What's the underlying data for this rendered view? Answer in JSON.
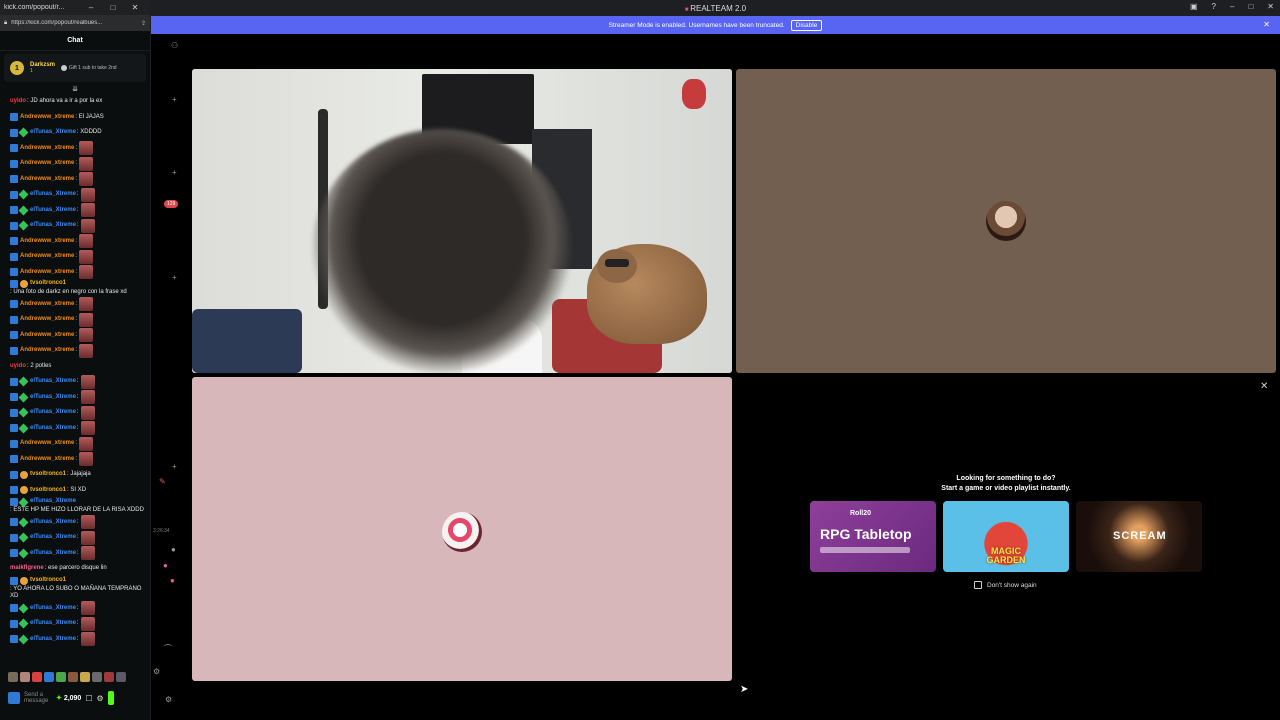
{
  "chat_window": {
    "title": "kick.com/popout/r...",
    "url": "https://kick.com/popout/realbues...",
    "header": "Chat",
    "pinned": {
      "avatar_letter": "1",
      "name": "Darkzsm",
      "sub_count": "1",
      "gift_text": "Gift 1 sub to take 2nd"
    },
    "collapse_icon": "chevron-double-down",
    "messages": [
      {
        "badges": [],
        "user": "uyido",
        "color": "red",
        "text": ": JD ahora va a ir a por la ex",
        "emote": false
      },
      {
        "badges": [
          "kick"
        ],
        "user": "Andrewww_xtreme",
        "color": "orange",
        "text": ": El JAJAS",
        "emote": false
      },
      {
        "badges": [
          "kick",
          "gem"
        ],
        "user": "elTunas_Xtreme",
        "color": "blue",
        "text": ": XDDDD",
        "emote": false
      },
      {
        "badges": [
          "kick"
        ],
        "user": "Andrewww_xtreme",
        "color": "orange",
        "text": ":",
        "emote": true
      },
      {
        "badges": [
          "kick"
        ],
        "user": "Andrewww_xtreme",
        "color": "orange",
        "text": ":",
        "emote": true
      },
      {
        "badges": [
          "kick"
        ],
        "user": "Andrewww_xtreme",
        "color": "orange",
        "text": ":",
        "emote": true
      },
      {
        "badges": [
          "kick",
          "gem"
        ],
        "user": "elTunas_Xtreme",
        "color": "blue",
        "text": ":",
        "emote": true
      },
      {
        "badges": [
          "kick",
          "gem"
        ],
        "user": "elTunas_Xtreme",
        "color": "blue",
        "text": ":",
        "emote": true
      },
      {
        "badges": [
          "kick",
          "gem"
        ],
        "user": "elTunas_Xtreme",
        "color": "blue",
        "text": ":",
        "emote": true
      },
      {
        "badges": [
          "kick"
        ],
        "user": "Andrewww_xtreme",
        "color": "orange",
        "text": ":",
        "emote": true
      },
      {
        "badges": [
          "kick"
        ],
        "user": "Andrewww_xtreme",
        "color": "orange",
        "text": ":",
        "emote": true
      },
      {
        "badges": [
          "kick"
        ],
        "user": "Andrewww_xtreme",
        "color": "orange",
        "text": ":",
        "emote": true
      },
      {
        "badges": [
          "kick",
          "crown"
        ],
        "user": "tvsoltronco1",
        "color": "gold",
        "text": ": Una foto de darkz en negro con la frase xd",
        "emote": false
      },
      {
        "badges": [
          "kick"
        ],
        "user": "Andrewww_xtreme",
        "color": "orange",
        "text": ":",
        "emote": true
      },
      {
        "badges": [
          "kick"
        ],
        "user": "Andrewww_xtreme",
        "color": "orange",
        "text": ":",
        "emote": true
      },
      {
        "badges": [
          "kick"
        ],
        "user": "Andrewww_xtreme",
        "color": "orange",
        "text": ":",
        "emote": true
      },
      {
        "badges": [
          "kick"
        ],
        "user": "Andrewww_xtreme",
        "color": "orange",
        "text": ":",
        "emote": true
      },
      {
        "badges": [],
        "user": "uyido",
        "color": "red",
        "text": ": 2 potles",
        "emote": false
      },
      {
        "badges": [
          "kick",
          "gem"
        ],
        "user": "elTunas_Xtreme",
        "color": "blue",
        "text": ":",
        "emote": true
      },
      {
        "badges": [
          "kick",
          "gem"
        ],
        "user": "elTunas_Xtreme",
        "color": "blue",
        "text": ":",
        "emote": true
      },
      {
        "badges": [
          "kick",
          "gem"
        ],
        "user": "elTunas_Xtreme",
        "color": "blue",
        "text": ":",
        "emote": true
      },
      {
        "badges": [
          "kick",
          "gem"
        ],
        "user": "elTunas_Xtreme",
        "color": "blue",
        "text": ":",
        "emote": true
      },
      {
        "badges": [
          "kick"
        ],
        "user": "Andrewww_xtreme",
        "color": "orange",
        "text": ":",
        "emote": true
      },
      {
        "badges": [
          "kick"
        ],
        "user": "Andrewww_xtreme",
        "color": "orange",
        "text": ":",
        "emote": true
      },
      {
        "badges": [
          "kick",
          "crown"
        ],
        "user": "tvsoltronco1",
        "color": "gold",
        "text": ": Jajajaja",
        "emote": false
      },
      {
        "badges": [
          "kick",
          "crown"
        ],
        "user": "tvsoltronco1",
        "color": "gold",
        "text": ": SI XD",
        "emote": false
      },
      {
        "badges": [
          "kick",
          "gem"
        ],
        "user": "elTunas_Xtreme",
        "color": "blue",
        "text": ": ESTE HP ME HIZO LLORAR DE LA RISA XDDD",
        "emote": false
      },
      {
        "badges": [
          "kick",
          "gem"
        ],
        "user": "elTunas_Xtreme",
        "color": "blue",
        "text": ":",
        "emote": true
      },
      {
        "badges": [
          "kick",
          "gem"
        ],
        "user": "elTunas_Xtreme",
        "color": "blue",
        "text": ":",
        "emote": true
      },
      {
        "badges": [
          "kick",
          "gem"
        ],
        "user": "elTunas_Xtreme",
        "color": "blue",
        "text": ":",
        "emote": true
      },
      {
        "badges": [],
        "user": "maikflgrene",
        "color": "pink",
        "text": ": ese parcero disque lin",
        "emote": false
      },
      {
        "badges": [
          "kick",
          "crown"
        ],
        "user": "tvsoltronco1",
        "color": "gold",
        "text": ": YO AHORA LO SUBO O MAÑANA TEMPRANO XD",
        "emote": false
      },
      {
        "badges": [
          "kick",
          "gem"
        ],
        "user": "elTunas_Xtreme",
        "color": "blue",
        "text": ":",
        "emote": true
      },
      {
        "badges": [
          "kick",
          "gem"
        ],
        "user": "elTunas_Xtreme",
        "color": "blue",
        "text": ":",
        "emote": true
      },
      {
        "badges": [
          "kick",
          "gem"
        ],
        "user": "elTunas_Xtreme",
        "color": "blue",
        "text": ":",
        "emote": true
      }
    ],
    "input": {
      "placeholder": "Send a message",
      "points": "2,090"
    }
  },
  "app": {
    "title": "REALTEAM 2.0",
    "notification_count": "129",
    "timer": "3:26:34",
    "banner_text": "Streamer Mode is enabled. Usernames have been truncated.",
    "banner_button": "Disable"
  },
  "activity": {
    "heading": "Looking for something to do?",
    "subheading": "Start a game or video playlist instantly.",
    "cards": [
      {
        "brand": "Roll20",
        "title": "RPG Tabletop"
      },
      {
        "brand": "",
        "title": "MAGIC GARDEN"
      },
      {
        "brand": "",
        "title": "SCREAM"
      }
    ],
    "dont_show": "Don't show again"
  },
  "colors": {
    "banner": "#5865f2",
    "kick_green": "#53fc18",
    "tile_brown": "#735f4f",
    "tile_pink": "#d8b7ba"
  }
}
